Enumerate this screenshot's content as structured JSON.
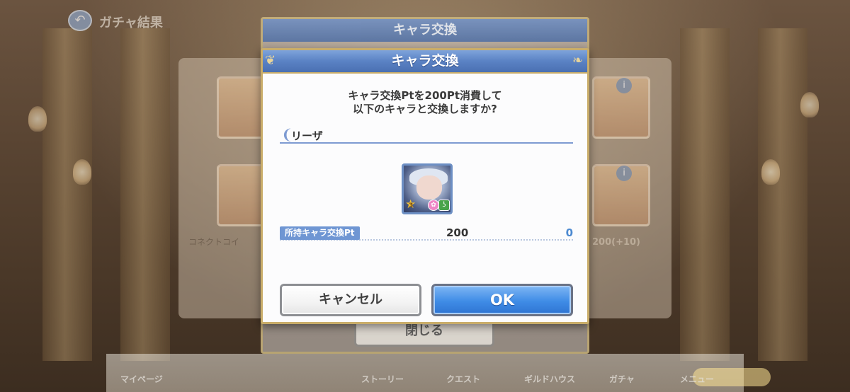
{
  "background": {
    "back_label": "ガチャ結果",
    "back_dialog_title": "キャラ交換",
    "connect_label": "コネクトコイ",
    "ratio_label": "200(+10)",
    "close_button": "閉じる",
    "nav": [
      "マイページ",
      "ストーリー",
      "クエスト",
      "ギルドハウス",
      "ガチャ",
      "メニュー"
    ]
  },
  "modal": {
    "title": "キャラ交換",
    "message_line1": "キャラ交換Ptを200Pt消費して",
    "message_line2": "以下のキャラと交換しますか?",
    "character_name": "リーザ",
    "character_stars": "3",
    "points_label": "所持キャラ交換Pt",
    "points_current": "200",
    "points_after": "0",
    "cancel_label": "キャンセル",
    "ok_label": "OK"
  },
  "colors": {
    "header_blue": "#5a82c4",
    "ok_blue": "#3f8ce6",
    "gold_border": "#c9ad6a",
    "points_after": "#4d8ad1"
  }
}
